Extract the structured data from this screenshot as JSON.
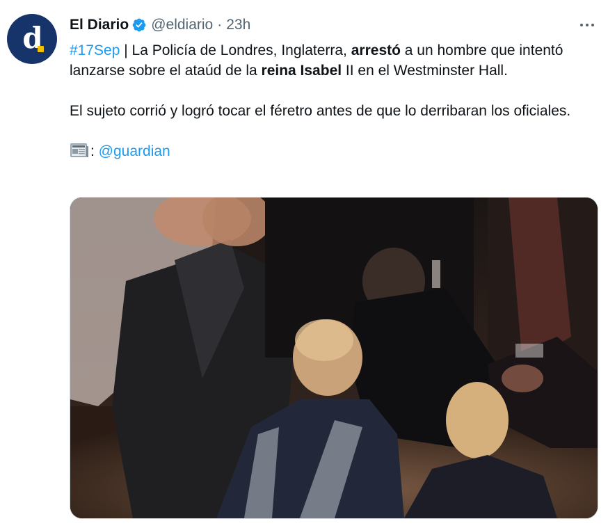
{
  "tweet": {
    "avatar": {
      "letter": "d",
      "dot_color": "#f2c200",
      "bg_color": "#16346a"
    },
    "author": {
      "display_name": "El Diario",
      "verified_icon": "verified-badge-icon",
      "handle": "@eldiario",
      "separator": "·",
      "time": "23h"
    },
    "more_icon": "more-options-icon",
    "text": {
      "p1": {
        "hashtag": "#17Sep",
        "t1": " | La Policía de Londres, Inglaterra, ",
        "b1": "arrestó",
        "t2": " a un hombre que intentó lanzarse sobre el ataúd de la ",
        "b2": "reina Isabel",
        "t3": " II en el Westminster Hall."
      },
      "p2": "El sujeto corrió y logró tocar el féretro antes de que lo derribaran los oficiales.",
      "p3": {
        "icon": "newspaper-icon",
        "colon": ": ",
        "mention": "@guardian"
      }
    },
    "colors": {
      "link": "#1d9bf0",
      "muted": "#536471",
      "text": "#0f1419"
    }
  }
}
